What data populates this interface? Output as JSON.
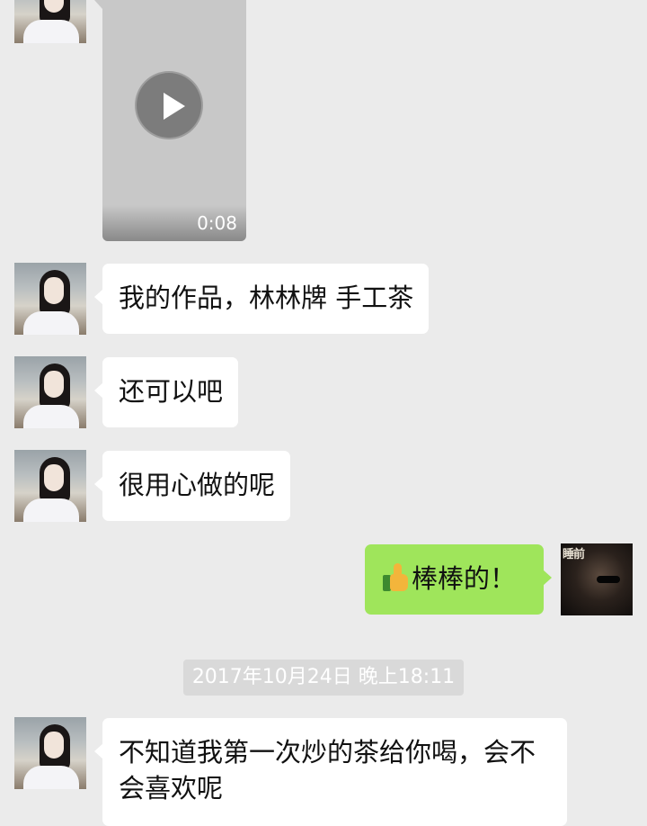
{
  "video_message": {
    "duration": "0:08"
  },
  "messages": [
    {
      "side": "left",
      "text": "我的作品，林林牌 手工茶"
    },
    {
      "side": "left",
      "text": "还可以吧"
    },
    {
      "side": "left",
      "text": "很用心做的呢"
    },
    {
      "side": "right",
      "text": "棒棒的！",
      "emoji": "thumbs-up"
    }
  ],
  "timestamp": "2017年10月24日 晚上18:11",
  "last_message": {
    "side": "left",
    "text": "不知道我第一次炒的茶给你喝，会不会喜欢呢"
  },
  "my_avatar_caption": "睡前",
  "colors": {
    "background": "#ebebeb",
    "incoming_bubble": "#ffffff",
    "outgoing_bubble": "#9fe55b",
    "timestamp_pill": "#d9d9d9"
  }
}
